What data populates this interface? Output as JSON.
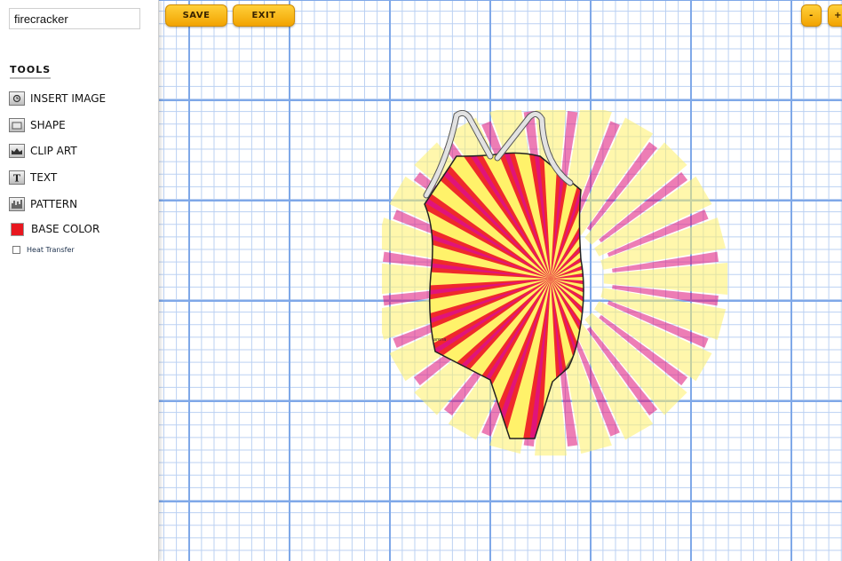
{
  "sidebar": {
    "design_name": "firecracker",
    "tools_heading": "TOOLS",
    "tools": [
      {
        "label": "INSERT IMAGE",
        "icon": "insert-image-icon"
      },
      {
        "label": "SHAPE",
        "icon": "shape-icon"
      },
      {
        "label": "CLIP ART",
        "icon": "clip-art-icon"
      },
      {
        "label": "TEXT",
        "icon": "text-icon"
      },
      {
        "label": "PATTERN",
        "icon": "pattern-icon"
      },
      {
        "label": "BASE COLOR",
        "icon": "base-color-swatch"
      }
    ],
    "heat_transfer_label": "Heat Transfer",
    "heat_transfer_checked": false,
    "base_color": "#e8171f"
  },
  "toolbar": {
    "save_label": "SAVE",
    "exit_label": "EXIT",
    "zoom_out_label": "-",
    "zoom_in_label": "+"
  },
  "design": {
    "garment": "one-piece swimsuit",
    "pattern": "sunburst rays",
    "colors": {
      "primary": "#ef2a2a",
      "secondary": "#fff26a",
      "ray_overlay": "#e0147a",
      "straps": "#dedede"
    }
  }
}
